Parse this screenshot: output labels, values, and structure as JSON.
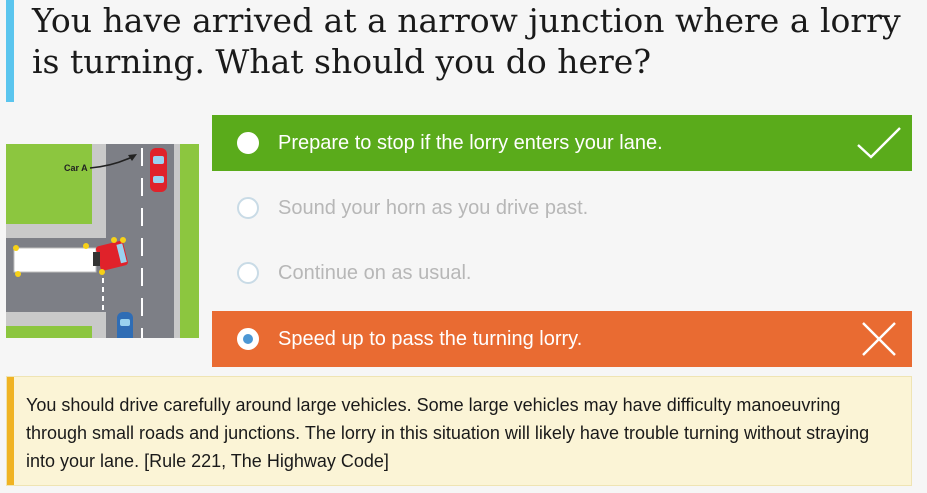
{
  "question": {
    "text": "You have arrived at a narrow junction where a lorry is turning. What should you do here?"
  },
  "scene": {
    "car_label": "Car A"
  },
  "options": [
    {
      "label": "Prepare to stop if the lorry enters your lane.",
      "state": "correct"
    },
    {
      "label": "Sound your horn as you drive past.",
      "state": "unselected"
    },
    {
      "label": "Continue on as usual.",
      "state": "unselected"
    },
    {
      "label": "Speed up to pass the turning lorry.",
      "state": "selected-incorrect"
    }
  ],
  "explanation": {
    "text": "You should drive carefully around large vehicles. Some large vehicles may have difficulty manoeuvring through small roads and junctions. The lorry in this situation will likely have trouble turning without straying into your lane. [Rule 221, The Highway Code]"
  },
  "colors": {
    "correct": "#5aab1b",
    "incorrect": "#e96b32",
    "question_accent": "#5bc5ee",
    "explanation_accent": "#f0b323",
    "explanation_bg": "#fbf4d6"
  }
}
